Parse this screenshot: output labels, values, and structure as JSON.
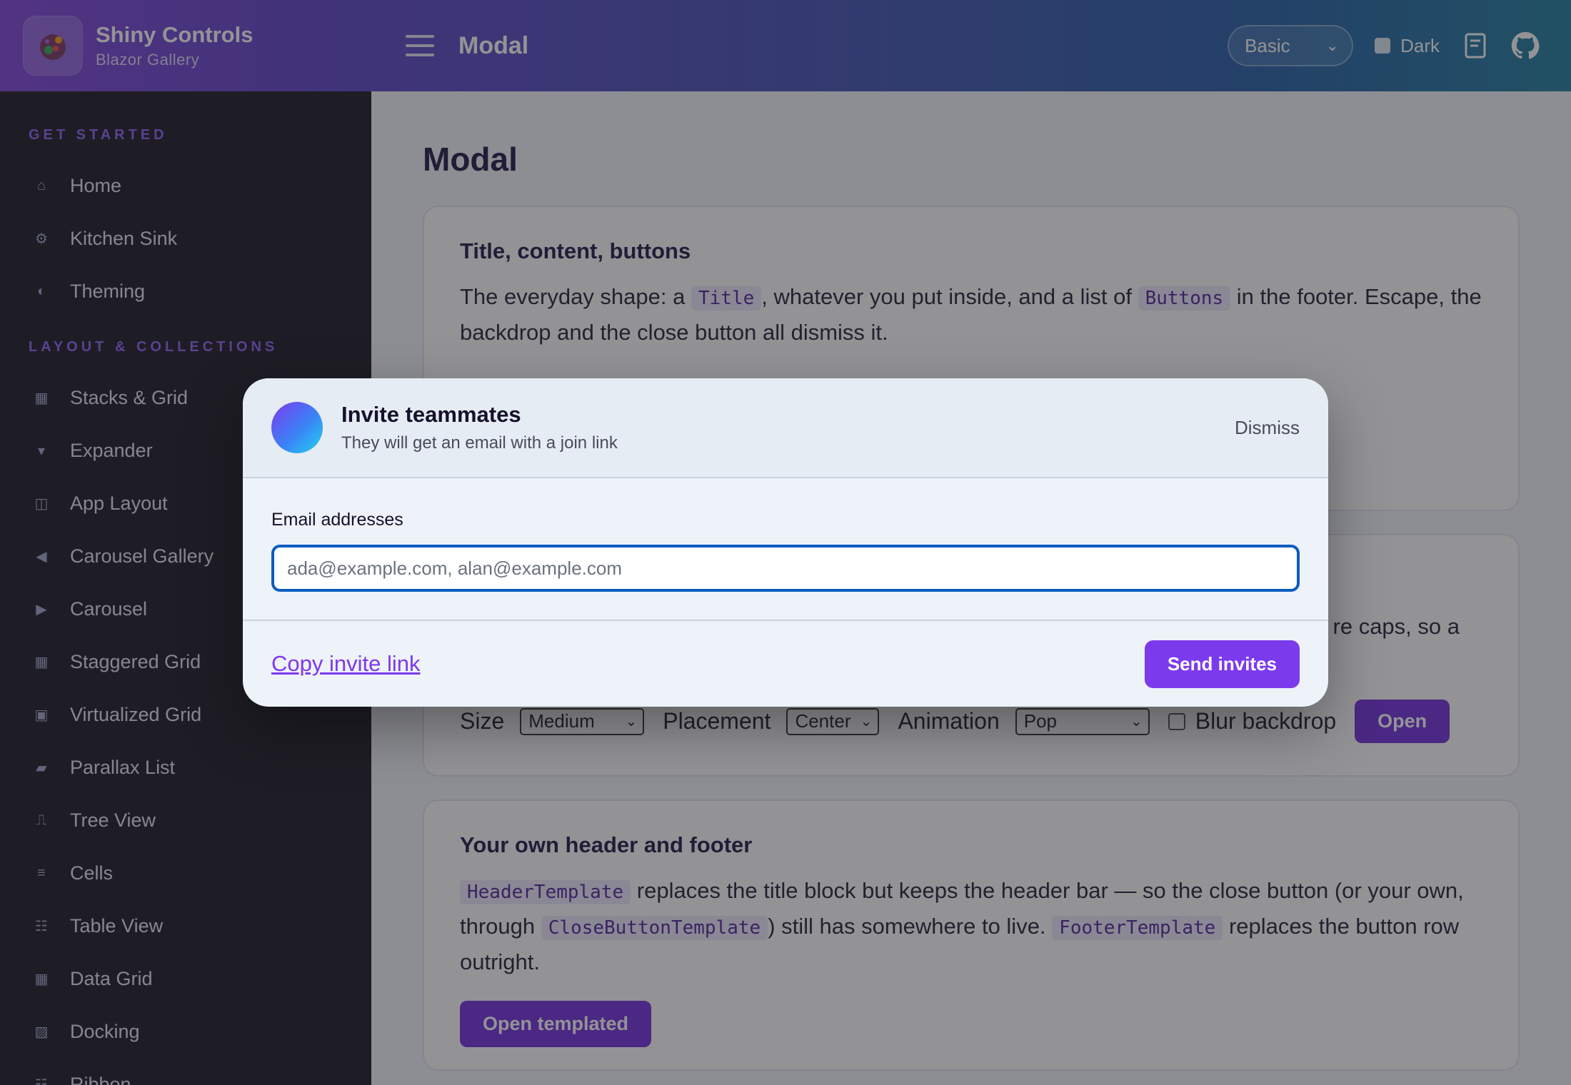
{
  "header": {
    "brand_title": "Shiny Controls",
    "brand_sub": "Blazor Gallery",
    "page_title": "Modal",
    "theme_selected": "Basic",
    "dark_label": "Dark",
    "icons": [
      "book-icon",
      "github-icon"
    ]
  },
  "sidebar": {
    "sections": [
      {
        "title": "GET STARTED",
        "items": [
          {
            "icon": "⌂",
            "label": "Home"
          },
          {
            "icon": "⚙",
            "label": "Kitchen Sink"
          },
          {
            "icon": "◐",
            "label": "Theming"
          }
        ]
      },
      {
        "title": "LAYOUT & COLLECTIONS",
        "items": [
          {
            "icon": "▦",
            "label": "Stacks & Grid"
          },
          {
            "icon": "▾",
            "label": "Expander"
          },
          {
            "icon": "◫",
            "label": "App Layout"
          },
          {
            "icon": "◀",
            "label": "Carousel Gallery"
          },
          {
            "icon": "▶",
            "label": "Carousel"
          },
          {
            "icon": "▦",
            "label": "Staggered Grid"
          },
          {
            "icon": "▣",
            "label": "Virtualized Grid"
          },
          {
            "icon": "▰",
            "label": "Parallax List"
          },
          {
            "icon": "⎍",
            "label": "Tree View"
          },
          {
            "icon": "≡",
            "label": "Cells"
          },
          {
            "icon": "☷",
            "label": "Table View"
          },
          {
            "icon": "▦",
            "label": "Data Grid"
          },
          {
            "icon": "▨",
            "label": "Docking"
          },
          {
            "icon": "☷",
            "label": "Ribbon"
          }
        ]
      }
    ]
  },
  "main": {
    "title": "Modal",
    "card1": {
      "title": "Title, content, buttons",
      "p_a": "The everyday shape: a ",
      "code_title": "Title",
      "p_b": ", whatever you put inside, and a list of ",
      "code_buttons": "Buttons",
      "p_c": " in the footer. Escape, the backdrop and the close button all dismiss it."
    },
    "card2": {
      "text_visible": "re caps, so a",
      "size_label": "Size",
      "size_value": "Medium",
      "placement_label": "Placement",
      "placement_value": "Center",
      "animation_label": "Animation",
      "animation_value": "Pop",
      "blur_label": "Blur backdrop",
      "open_label": "Open"
    },
    "card3": {
      "title": "Your own header and footer",
      "code_header": "HeaderTemplate",
      "p_a": " replaces the title block but keeps the header bar — so the close button (or your own, through ",
      "code_close": "CloseButtonTemplate",
      "p_b": ") still has somewhere to live. ",
      "code_footer": "FooterTemplate",
      "p_c": " replaces the button row outright.",
      "button": "Open templated"
    }
  },
  "modal": {
    "title": "Invite teammates",
    "subtitle": "They will get an email with a join link",
    "dismiss": "Dismiss",
    "field_label": "Email addresses",
    "field_placeholder": "ada@example.com, alan@example.com",
    "copy_link": "Copy invite link",
    "send": "Send invites"
  },
  "colors": {
    "accent": "#7c3aed",
    "sidebar_bg": "#14121c",
    "input_focus": "#0a5cc2"
  }
}
